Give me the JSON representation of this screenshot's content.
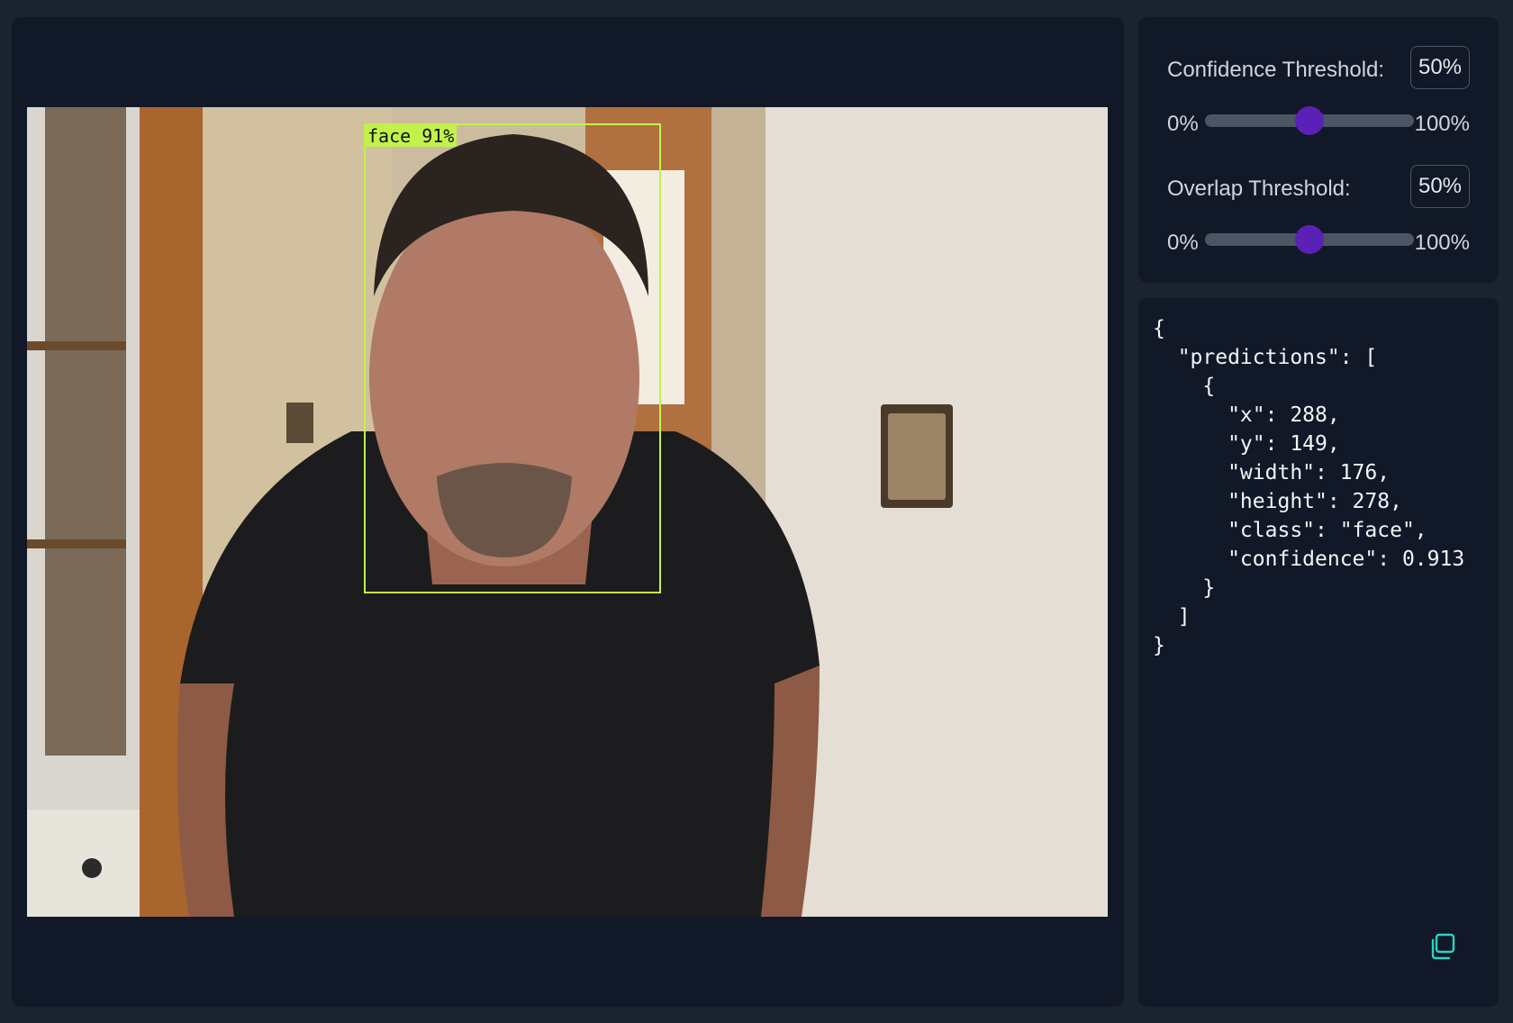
{
  "detection": {
    "label": "face 91%"
  },
  "controls": {
    "confidence": {
      "label": "Confidence Threshold:",
      "value_text": "50%",
      "min_label": "0%",
      "max_label": "100%",
      "value": 0.5
    },
    "overlap": {
      "label": "Overlap Threshold:",
      "value_text": "50%",
      "min_label": "0%",
      "max_label": "100%",
      "value": 0.5
    }
  },
  "json_output": {
    "text": "{\n  \"predictions\": [\n    {\n      \"x\": 288,\n      \"y\": 149,\n      \"width\": 176,\n      \"height\": 278,\n      \"class\": \"face\",\n      \"confidence\": 0.913\n    }\n  ]\n}"
  },
  "icons": {
    "copy": "copy-icon"
  },
  "colors": {
    "bbox": "#c1f24b",
    "slider_thumb": "#5b21b6",
    "copy_icon": "#2dd4bf"
  }
}
